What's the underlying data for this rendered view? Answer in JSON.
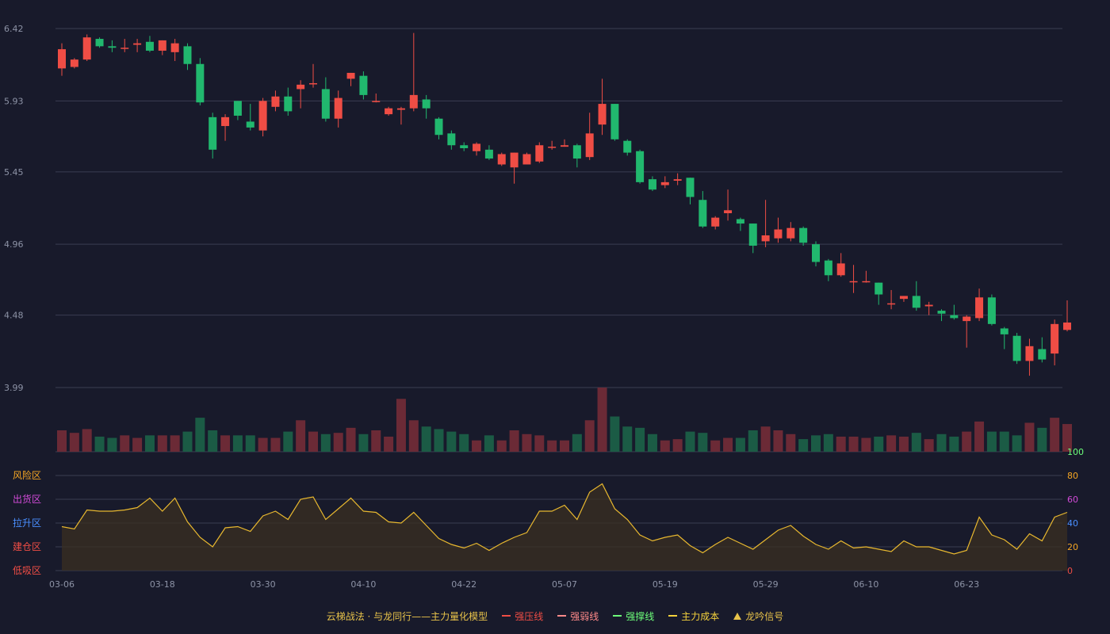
{
  "chart_data": {
    "type": "candlestick",
    "price_axis": {
      "ticks": [
        "6.42",
        "5.93",
        "5.45",
        "4.96",
        "4.48",
        "3.99"
      ],
      "range": [
        3.99,
        6.42
      ]
    },
    "x_ticks": [
      "03-06",
      "03-18",
      "03-30",
      "04-10",
      "04-22",
      "05-07",
      "05-19",
      "05-29",
      "06-10",
      "06-23"
    ],
    "x_tick_index": [
      0,
      8,
      16,
      24,
      32,
      40,
      48,
      56,
      64,
      72
    ],
    "candles": [
      [
        6.15,
        6.28,
        6.1,
        6.32
      ],
      [
        6.16,
        6.21,
        6.15,
        6.22
      ],
      [
        6.21,
        6.36,
        6.2,
        6.38
      ],
      [
        6.35,
        6.3,
        6.29,
        6.36
      ],
      [
        6.3,
        6.29,
        6.26,
        6.34
      ],
      [
        6.29,
        6.29,
        6.26,
        6.35
      ],
      [
        6.31,
        6.32,
        6.26,
        6.35
      ],
      [
        6.33,
        6.27,
        6.26,
        6.37
      ],
      [
        6.27,
        6.34,
        6.24,
        6.34
      ],
      [
        6.26,
        6.32,
        6.2,
        6.35
      ],
      [
        6.3,
        6.18,
        6.14,
        6.32
      ],
      [
        6.18,
        5.92,
        5.9,
        6.22
      ],
      [
        5.82,
        5.6,
        5.54,
        5.85
      ],
      [
        5.76,
        5.82,
        5.66,
        5.84
      ],
      [
        5.93,
        5.83,
        5.8,
        5.93
      ],
      [
        5.79,
        5.75,
        5.73,
        5.91
      ],
      [
        5.73,
        5.93,
        5.69,
        5.95
      ],
      [
        5.89,
        5.96,
        5.86,
        6.0
      ],
      [
        5.96,
        5.86,
        5.83,
        6.02
      ],
      [
        6.01,
        6.04,
        5.88,
        6.07
      ],
      [
        6.05,
        6.05,
        6.02,
        6.18
      ],
      [
        6.01,
        5.81,
        5.79,
        6.09
      ],
      [
        5.81,
        5.95,
        5.75,
        6.0
      ],
      [
        6.08,
        6.12,
        6.03,
        6.12
      ],
      [
        6.1,
        5.97,
        5.94,
        6.13
      ],
      [
        5.93,
        5.93,
        5.92,
        5.98
      ],
      [
        5.84,
        5.88,
        5.83,
        5.89
      ],
      [
        5.87,
        5.88,
        5.77,
        5.89
      ],
      [
        5.88,
        5.97,
        5.86,
        6.39
      ],
      [
        5.94,
        5.88,
        5.81,
        5.97
      ],
      [
        5.81,
        5.7,
        5.67,
        5.82
      ],
      [
        5.71,
        5.63,
        5.6,
        5.73
      ],
      [
        5.63,
        5.61,
        5.59,
        5.65
      ],
      [
        5.59,
        5.64,
        5.56,
        5.65
      ],
      [
        5.6,
        5.54,
        5.53,
        5.63
      ],
      [
        5.5,
        5.57,
        5.49,
        5.58
      ],
      [
        5.48,
        5.58,
        5.37,
        5.58
      ],
      [
        5.5,
        5.57,
        5.5,
        5.58
      ],
      [
        5.52,
        5.63,
        5.51,
        5.65
      ],
      [
        5.62,
        5.62,
        5.6,
        5.66
      ],
      [
        5.62,
        5.63,
        5.62,
        5.67
      ],
      [
        5.63,
        5.54,
        5.48,
        5.64
      ],
      [
        5.55,
        5.71,
        5.53,
        5.85
      ],
      [
        5.77,
        5.91,
        5.7,
        6.08
      ],
      [
        5.91,
        5.67,
        5.66,
        5.91
      ],
      [
        5.66,
        5.58,
        5.56,
        5.67
      ],
      [
        5.59,
        5.38,
        5.37,
        5.6
      ],
      [
        5.4,
        5.33,
        5.32,
        5.42
      ],
      [
        5.36,
        5.38,
        5.34,
        5.42
      ],
      [
        5.39,
        5.4,
        5.36,
        5.44
      ],
      [
        5.41,
        5.28,
        5.23,
        5.41
      ],
      [
        5.26,
        5.08,
        5.07,
        5.32
      ],
      [
        5.08,
        5.14,
        5.06,
        5.15
      ],
      [
        5.17,
        5.19,
        5.12,
        5.33
      ],
      [
        5.13,
        5.1,
        5.05,
        5.14
      ],
      [
        5.1,
        4.95,
        4.9,
        5.1
      ],
      [
        4.98,
        5.02,
        4.94,
        5.26
      ],
      [
        5.0,
        5.06,
        4.97,
        5.14
      ],
      [
        5.0,
        5.07,
        4.98,
        5.11
      ],
      [
        5.07,
        4.97,
        4.95,
        5.08
      ],
      [
        4.96,
        4.84,
        4.81,
        4.98
      ],
      [
        4.85,
        4.75,
        4.71,
        4.86
      ],
      [
        4.75,
        4.83,
        4.74,
        4.9
      ],
      [
        4.71,
        4.71,
        4.63,
        4.82
      ],
      [
        4.71,
        4.71,
        4.7,
        4.78
      ],
      [
        4.7,
        4.62,
        4.55,
        4.7
      ],
      [
        4.56,
        4.56,
        4.52,
        4.65
      ],
      [
        4.59,
        4.61,
        4.57,
        4.61
      ],
      [
        4.61,
        4.53,
        4.51,
        4.71
      ],
      [
        4.54,
        4.55,
        4.48,
        4.57
      ],
      [
        4.51,
        4.49,
        4.44,
        4.52
      ],
      [
        4.48,
        4.46,
        4.45,
        4.55
      ],
      [
        4.44,
        4.47,
        4.26,
        4.48
      ],
      [
        4.46,
        4.6,
        4.44,
        4.66
      ],
      [
        4.6,
        4.42,
        4.41,
        4.62
      ],
      [
        4.39,
        4.35,
        4.25,
        4.4
      ],
      [
        4.34,
        4.17,
        4.15,
        4.36
      ],
      [
        4.17,
        4.27,
        4.07,
        4.32
      ],
      [
        4.25,
        4.18,
        4.16,
        4.33
      ],
      [
        4.22,
        4.42,
        4.14,
        4.45
      ],
      [
        4.38,
        4.43,
        4.37,
        4.58
      ]
    ],
    "volume": [
      17,
      15,
      18,
      12,
      11,
      13,
      11,
      13,
      13,
      13,
      16,
      27,
      17,
      13,
      13,
      13,
      11,
      11,
      16,
      25,
      16,
      14,
      15,
      19,
      14,
      17,
      12,
      42,
      25,
      20,
      18,
      16,
      14,
      9,
      13,
      9,
      17,
      14,
      13,
      9,
      9,
      14,
      25,
      51,
      28,
      20,
      19,
      14,
      9,
      10,
      16,
      15,
      9,
      11,
      11,
      17,
      20,
      17,
      14,
      10,
      13,
      14,
      12,
      12,
      11,
      12,
      13,
      12,
      15,
      10,
      14,
      12,
      16,
      24,
      16,
      16,
      13,
      23,
      19,
      27,
      22
    ],
    "oscillator": {
      "axis_ticks": [
        "100",
        "80",
        "60",
        "40",
        "20",
        "0"
      ],
      "zones": [
        "风险区",
        "出货区",
        "拉升区",
        "建仓区",
        "低吸区"
      ],
      "range": [
        0,
        100
      ],
      "values": [
        37,
        35,
        51,
        50,
        50,
        51,
        53,
        61,
        50,
        61,
        41,
        28,
        20,
        36,
        37,
        33,
        46,
        50,
        43,
        60,
        62,
        43,
        52,
        61,
        50,
        49,
        41,
        40,
        49,
        38,
        27,
        22,
        19,
        23,
        17,
        23,
        28,
        32,
        50,
        50,
        55,
        43,
        66,
        73,
        52,
        43,
        30,
        25,
        28,
        30,
        21,
        15,
        22,
        28,
        23,
        18,
        26,
        34,
        38,
        29,
        22,
        18,
        25,
        19,
        20,
        18,
        16,
        25,
        20,
        20,
        17,
        14,
        17,
        45,
        30,
        26,
        18,
        31,
        25,
        45,
        49
      ]
    }
  },
  "legend": {
    "title": "云梯战法 · 与龙同行——主力量化模型",
    "items": [
      {
        "label": "强压线",
        "color": "#ef4d45"
      },
      {
        "label": "强弱线",
        "color": "#ff8a8a"
      },
      {
        "label": "强撑线",
        "color": "#6dff7a"
      },
      {
        "label": "主力成本",
        "color": "#f5d23c"
      },
      {
        "label": "龙吟信号",
        "color": "#e8c34a"
      }
    ]
  },
  "colors": {
    "background": "#181a2b",
    "up": "#ef4d45",
    "down": "#21b86e",
    "vol_up": "#6b2a36",
    "vol_down": "#1b5b45",
    "line": "#e8b82f",
    "grid": "#3a3d52"
  }
}
